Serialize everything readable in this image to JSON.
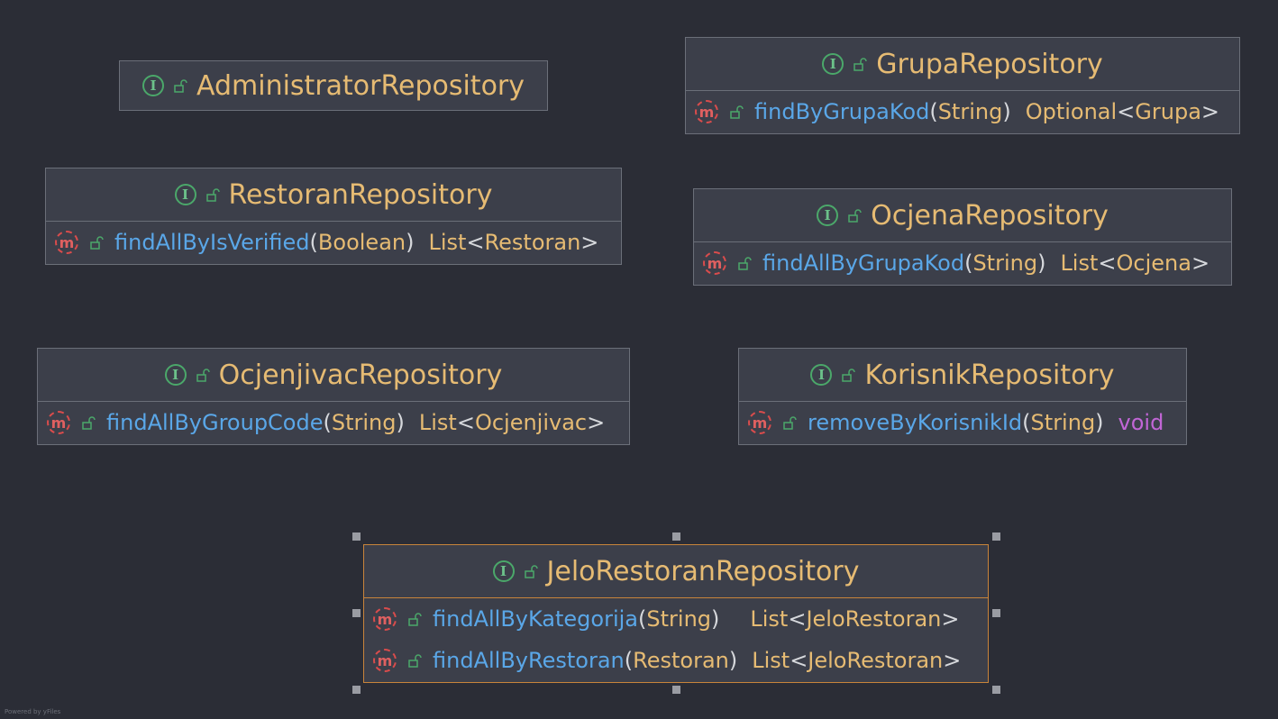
{
  "diagram": {
    "nodes": {
      "administrator": {
        "name": "AdministratorRepository",
        "methods": []
      },
      "grupa": {
        "name": "GrupaRepository",
        "methods": [
          {
            "name": "findByGrupaKod",
            "open": "(",
            "param": "String",
            "close": ")",
            "ret_a": "Optional",
            "ret_lt": "<",
            "ret_b": "Grupa",
            "ret_gt": ">"
          }
        ]
      },
      "restoran": {
        "name": "RestoranRepository",
        "methods": [
          {
            "name": "findAllByIsVerified",
            "open": "(",
            "param": "Boolean",
            "close": ")",
            "ret_a": "List",
            "ret_lt": "<",
            "ret_b": "Restoran",
            "ret_gt": ">"
          }
        ]
      },
      "ocjena": {
        "name": "OcjenaRepository",
        "methods": [
          {
            "name": "findAllByGrupaKod",
            "open": "(",
            "param": "String",
            "close": ")",
            "ret_a": "List",
            "ret_lt": "<",
            "ret_b": "Ocjena",
            "ret_gt": ">"
          }
        ]
      },
      "ocjenjivac": {
        "name": "OcjenjivacRepository",
        "methods": [
          {
            "name": "findAllByGroupCode",
            "open": "(",
            "param": "String",
            "close": ")",
            "ret_a": "List",
            "ret_lt": "<",
            "ret_b": "Ocjenjivac",
            "ret_gt": ">"
          }
        ]
      },
      "korisnik": {
        "name": "KorisnikRepository",
        "methods": [
          {
            "name": "removeByKorisnikId",
            "open": "(",
            "param": "String",
            "close": ")",
            "ret_kw": "void"
          }
        ]
      },
      "jelo": {
        "name": "JeloRestoranRepository",
        "methods": [
          {
            "name": "findAllByKategorija",
            "open": "(",
            "param": "String",
            "close": ")",
            "ret_a": "List",
            "ret_lt": "<",
            "ret_b": "JeloRestoran",
            "ret_gt": ">"
          },
          {
            "name": "findAllByRestoran",
            "open": "(",
            "param": "Restoran",
            "close": ")",
            "ret_a": "List",
            "ret_lt": "<",
            "ret_b": "JeloRestoran",
            "ret_gt": ">"
          }
        ]
      }
    },
    "icons": {
      "interface": "I",
      "method": "m"
    },
    "footer": "Powered by yFiles"
  }
}
